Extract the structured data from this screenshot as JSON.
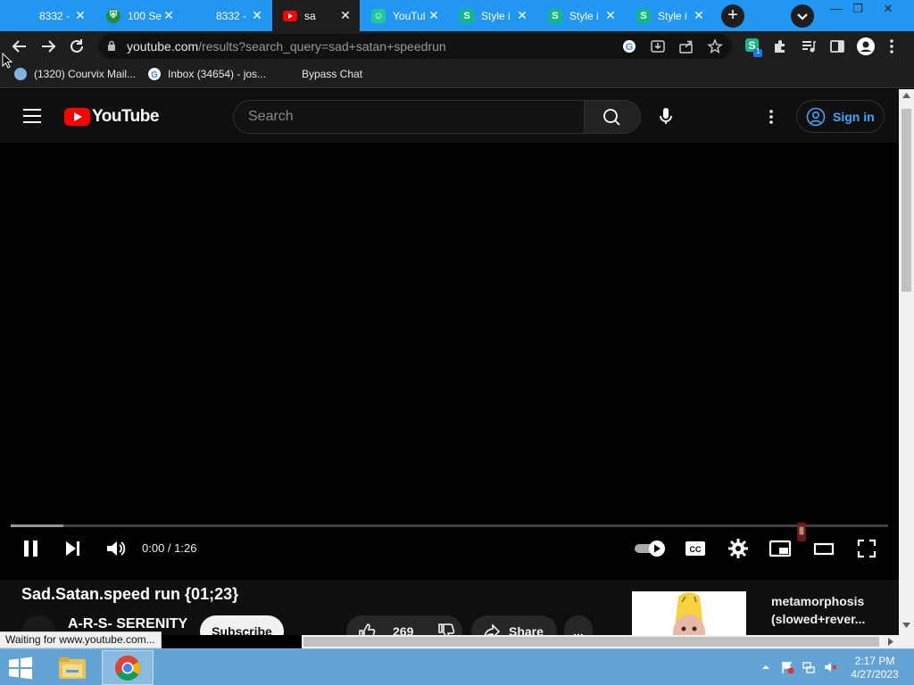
{
  "browser": {
    "tabs": [
      {
        "title": "8332 -",
        "favicon": "blank-icon",
        "active": false
      },
      {
        "title": "100 Se",
        "favicon": "shield-favicon",
        "active": false
      },
      {
        "title": "8332 -",
        "favicon": "blank-icon",
        "active": false
      },
      {
        "title": "sa",
        "favicon": "youtube-favicon",
        "active": true
      },
      {
        "title": "YouTul",
        "favicon": "robot-favicon",
        "active": false
      },
      {
        "title": "Style i",
        "favicon": "s-favicon",
        "active": false
      },
      {
        "title": "Style i",
        "favicon": "s-favicon",
        "active": false
      },
      {
        "title": "Style i",
        "favicon": "s-favicon",
        "active": false
      }
    ],
    "new_tab_symbol": "+",
    "address": {
      "host": "youtube.com",
      "path": "/results?search_query=sad+satan+speedrun"
    },
    "extension_badge": "1",
    "bookmarks": [
      {
        "label": "(1320) Courvix Mail...",
        "icon": "mail-icon"
      },
      {
        "label": "Inbox (34654) - jos...",
        "icon": "google-icon"
      },
      {
        "label": "Bypass Chat",
        "icon": "none"
      }
    ],
    "status_text": "Waiting for www.youtube.com..."
  },
  "youtube": {
    "logo_text": "YouTube",
    "search_placeholder": "Search",
    "sign_in_label": "Sign in",
    "player": {
      "time_current": "0:00",
      "time_total": "1:26",
      "time_separator": " / ",
      "loaded_fraction": 0.06,
      "autoplay_on": true
    },
    "video": {
      "title": "Sad.Satan.speed run {01;23}",
      "channel": "A-R-S- SERENITY",
      "subscribe_label": "Subscribe",
      "likes": "269",
      "share_label": "Share",
      "more_label": "..."
    },
    "recommendation": {
      "title": "metamorphosis (slowed+rever..."
    }
  },
  "taskbar": {
    "apps": [
      "file-explorer-icon",
      "chrome-icon"
    ],
    "clock_time": "2:17 PM",
    "clock_date": "4/27/2023"
  },
  "colors": {
    "tab_strip": "#2196f3",
    "chrome_dark": "#1e1e1e",
    "youtube_red": "#ff0000",
    "link_blue": "#3ea6ff",
    "taskbar": "#63a4d4"
  }
}
